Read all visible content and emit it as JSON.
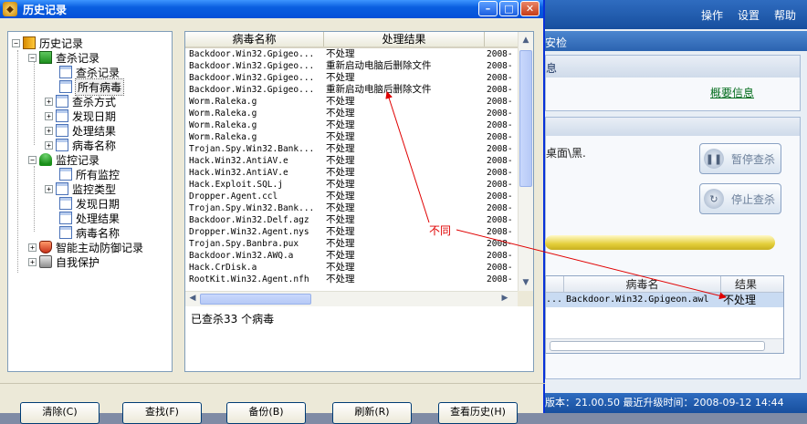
{
  "background_app": {
    "top_menu": [
      "操作",
      "设置",
      "帮助"
    ],
    "tab_label": "安检",
    "panel_label": "息",
    "summary_link": "概要信息",
    "scan_path": "桌面\\黑.",
    "pause_button": "暂停查杀",
    "stop_button": "停止查杀",
    "result_table": {
      "headers": [
        "病毒名",
        "结果"
      ],
      "row": {
        "prefix": "...",
        "virus": "Backdoor.Win32.Gpigeon.awl",
        "result": "不处理"
      }
    },
    "status_bar": "版本：21.00.50   最近升级时间：2008-09-12 14:44"
  },
  "window": {
    "title": "历史记录",
    "tree": {
      "root": "历史记录",
      "scan_records": "查杀记录",
      "scan_children": [
        "查杀记录",
        "所有病毒",
        "查杀方式",
        "发现日期",
        "处理结果",
        "病毒名称"
      ],
      "monitor_records": "监控记录",
      "monitor_children": [
        "所有监控",
        "监控类型",
        "发现日期",
        "处理结果",
        "病毒名称"
      ],
      "active_defense": "智能主动防御记录",
      "self_protect": "自我保护"
    },
    "list": {
      "headers": [
        "病毒名称",
        "处理结果",
        ""
      ],
      "rows": [
        [
          "Backdoor.Win32.Gpigeo...",
          "不处理",
          "2008-"
        ],
        [
          "Backdoor.Win32.Gpigeo...",
          "重新启动电脑后删除文件",
          "2008-"
        ],
        [
          "Backdoor.Win32.Gpigeo...",
          "不处理",
          "2008-"
        ],
        [
          "Backdoor.Win32.Gpigeo...",
          "重新启动电脑后删除文件",
          "2008-"
        ],
        [
          "Worm.Raleka.g",
          "不处理",
          "2008-"
        ],
        [
          "Worm.Raleka.g",
          "不处理",
          "2008-"
        ],
        [
          "Worm.Raleka.g",
          "不处理",
          "2008-"
        ],
        [
          "Worm.Raleka.g",
          "不处理",
          "2008-"
        ],
        [
          "Trojan.Spy.Win32.Bank...",
          "不处理",
          "2008-"
        ],
        [
          "Hack.Win32.AntiAV.e",
          "不处理",
          "2008-"
        ],
        [
          "Hack.Win32.AntiAV.e",
          "不处理",
          "2008-"
        ],
        [
          "Hack.Exploit.SQL.j",
          "不处理",
          "2008-"
        ],
        [
          "Dropper.Agent.ccl",
          "不处理",
          "2008-"
        ],
        [
          "Trojan.Spy.Win32.Bank...",
          "不处理",
          "2008-"
        ],
        [
          "Backdoor.Win32.Delf.agz",
          "不处理",
          "2008-"
        ],
        [
          "Dropper.Win32.Agent.nys",
          "不处理",
          "2008-"
        ],
        [
          "Trojan.Spy.Banbra.pux",
          "不处理",
          "2008-"
        ],
        [
          "Backdoor.Win32.AWQ.a",
          "不处理",
          "2008-"
        ],
        [
          "Hack.CrDisk.a",
          "不处理",
          "2008-"
        ],
        [
          "RootKit.Win32.Agent.nfh",
          "不处理",
          "2008-"
        ]
      ]
    },
    "killed_count": "已查杀33 个病毒",
    "buttons": [
      "清除(C)",
      "查找(F)",
      "备份(B)",
      "刷新(R)",
      "查看历史(H)"
    ]
  },
  "annotation": {
    "label": "不同",
    "color": "#e00000"
  }
}
